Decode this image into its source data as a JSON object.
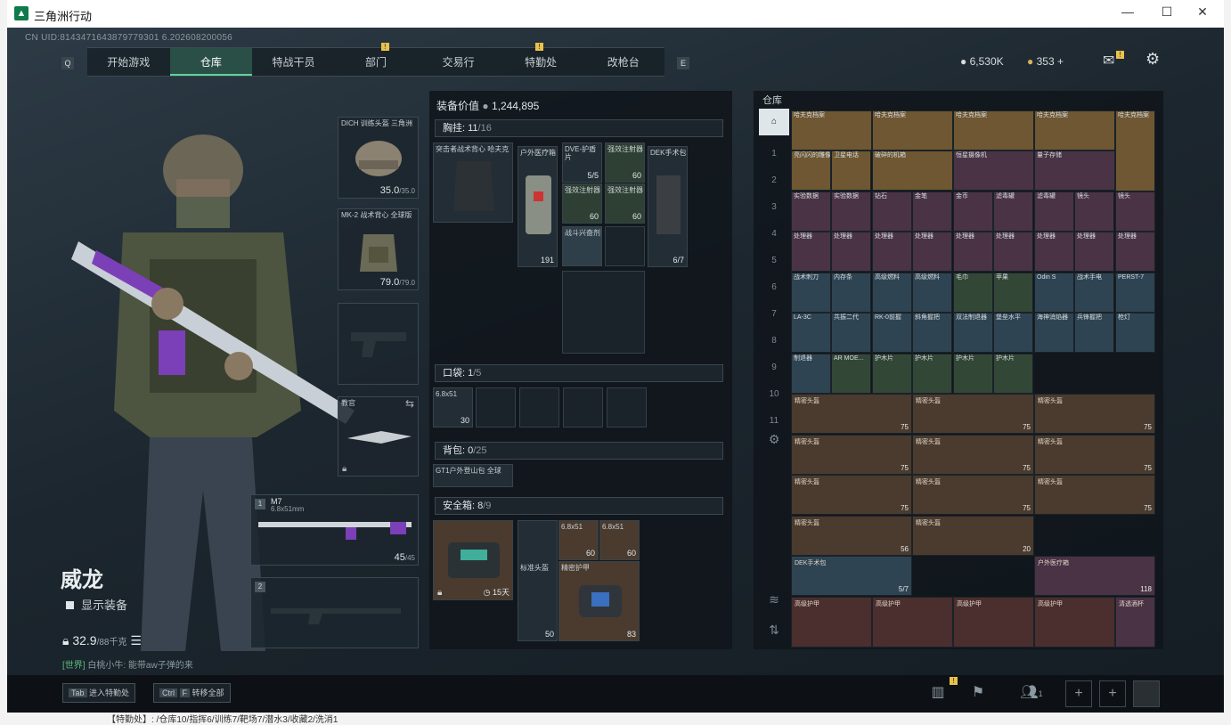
{
  "window": {
    "title": "三角洲行动",
    "minimize": "—",
    "maximize": "☐",
    "close": "✕"
  },
  "uid": "CN UID:8143471643879779301 6.202608200056",
  "nav": {
    "qkey_left": "Q",
    "qkey_right": "E",
    "tabs": [
      "开始游戏",
      "仓库",
      "特战干员",
      "部门",
      "交易行",
      "特勤处",
      "改枪台"
    ],
    "badge": "!"
  },
  "currency": {
    "koen": "6,530K",
    "coin": "353",
    "plus": "+"
  },
  "character": {
    "name": "威龙",
    "show_equipment": "显示装备",
    "weight": "32.9",
    "weight_max": "/88千克"
  },
  "chat": {
    "channel": "[世界]",
    "user": "白桃小牛",
    "message": "能带aw子弹的来"
  },
  "gear": {
    "helmet": {
      "label": "DICH 训练头盔 三角洲",
      "value": "35.0",
      "max": "/35.0"
    },
    "vest": {
      "label": "MK-2 战术背心 全球版",
      "value": "79.0",
      "max": "/79.0"
    },
    "melee": {
      "label": "教官"
    },
    "weapon1": {
      "num": "1",
      "name": "M7",
      "ammo": "6.8x51mm",
      "value": "45",
      "max": "/45"
    },
    "weapon2": {
      "num": "2"
    }
  },
  "equip": {
    "value_label": "装备价值",
    "value": "1,244,895",
    "chest": {
      "label": "胸挂:",
      "count": "11",
      "max": "/16"
    },
    "pocket": {
      "label": "口袋:",
      "count": "1",
      "max": "/5"
    },
    "backpack": {
      "label": "背包:",
      "count": "0",
      "max": "/25"
    },
    "safebox": {
      "label": "安全箱:",
      "count": "8",
      "max": "/9",
      "days": "15天"
    },
    "items": {
      "rig": {
        "label": "突击者战术背心 哈夫克"
      },
      "medkit": {
        "label": "户外医疗箱",
        "value": "191"
      },
      "dve": {
        "label": "DVE-护盾片",
        "value": "5/5"
      },
      "inj1": {
        "label": "强效注射器",
        "value": "60"
      },
      "inj2": {
        "label": "强效注射器",
        "value": "60"
      },
      "inj3": {
        "label": "强效注射器",
        "value": "60"
      },
      "dek": {
        "label": "DEK手术包",
        "value": "6/7"
      },
      "combat": {
        "label": "战斗兴奋剂"
      },
      "ammo_pocket": {
        "label": "6.8x51",
        "value": "30"
      },
      "bag": {
        "label": "GT1户外登山包 全球"
      },
      "safe_ammo1": {
        "label": "6.8x51",
        "value": "60"
      },
      "safe_ammo2": {
        "label": "6.8x51",
        "value": "60"
      },
      "safe_helmet": {
        "label": "标准头盔",
        "value": "50"
      },
      "safe_armor": {
        "label": "精密护甲",
        "value": "83"
      }
    }
  },
  "stash": {
    "title": "仓库",
    "side_tabs": [
      "1",
      "2",
      "3",
      "4",
      "5",
      "6",
      "7",
      "8",
      "9",
      "10",
      "11"
    ],
    "row1": [
      "哈夫克档案",
      "哈夫克档案",
      "哈夫克档案",
      "哈夫克档案",
      "哈夫克档案"
    ],
    "row2": [
      "亮闪闪的雕像",
      "卫星电话",
      "破碎的机箱",
      "恒星摄像机",
      "量子存储",
      ""
    ],
    "row3": [
      "实验数据",
      "实验数据",
      "钻石",
      "金笔",
      "金币",
      "滤毒罐",
      "滤毒罐",
      "镜头",
      "镜头"
    ],
    "row4": [
      "处理器",
      "处理器",
      "处理器",
      "处理器",
      "处理器",
      "处理器",
      "处理器",
      "处理器",
      "处理器"
    ],
    "row5": [
      "战术刺刀",
      "内存条",
      "高级燃料",
      "高级燃料",
      "毛巾",
      "苹果",
      "Odin S",
      "战术手电",
      "PERST-7"
    ],
    "row6": [
      "LA-3C",
      "共振二代",
      "RK-0前握",
      "斜角握把",
      "双法制退器",
      "堡垒水平",
      "海神消焰器",
      "兵锋握把",
      "枪灯"
    ],
    "row7": [
      "制退器",
      "AR MOE...",
      "护木片",
      "护木片",
      "护木片",
      "护木片"
    ],
    "helmets": [
      {
        "label": "精密头盔",
        "value": "75"
      },
      {
        "label": "精密头盔",
        "value": "75"
      },
      {
        "label": "精密头盔",
        "value": "75"
      },
      {
        "label": "精密头盔",
        "value": "75"
      },
      {
        "label": "精密头盔",
        "value": "75"
      },
      {
        "label": "精密头盔",
        "value": "75"
      },
      {
        "label": "精密头盔",
        "value": "75"
      },
      {
        "label": "精密头盔",
        "value": "75"
      },
      {
        "label": "精密头盔",
        "value": "75"
      },
      {
        "label": "精密头盔",
        "value": "56"
      },
      {
        "label": "精密头盔",
        "value": "20"
      }
    ],
    "dek": {
      "label": "DEK手术包",
      "value": "5/7"
    },
    "medbox": {
      "label": "户外医疗箱",
      "value": "118"
    },
    "armors": [
      "高级护甲",
      "高级护甲",
      "高级护甲",
      "高级护甲"
    ],
    "last": "清透酒杯"
  },
  "bottom": {
    "tab_key": "Tab",
    "tab_label": "进入特勤处",
    "ctrl": "Ctrl",
    "f": "F",
    "transfer": "转移全部",
    "players": "1"
  },
  "underlay": "【特勤处】: /仓库10/指挥6/训练7/靶场7/潜水3/收藏2/洗消1"
}
